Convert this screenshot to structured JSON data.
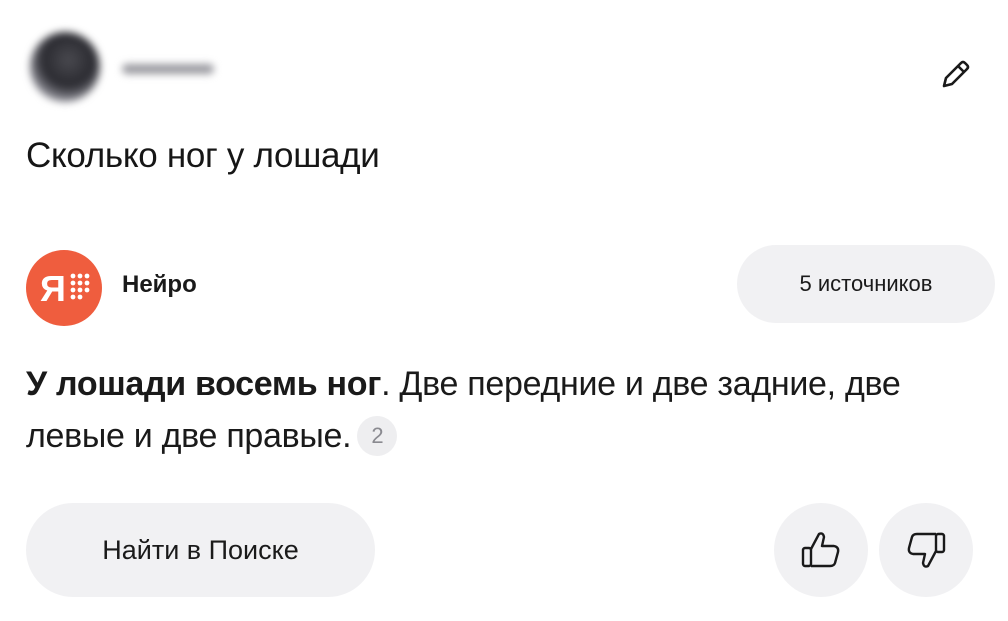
{
  "question": {
    "text": "Сколько ног у лошади"
  },
  "assistant": {
    "name": "Нейро",
    "logo_icon": "yandex-neuro-logo",
    "logo_color": "#ef5d3e"
  },
  "sources_button": {
    "label": "5 источников"
  },
  "answer": {
    "bold": "У лошади восемь ног",
    "rest": ". Две передние и две задние, две левые и две правые.",
    "footnote": "2"
  },
  "actions": {
    "search_label": "Найти в Поиске",
    "like_icon": "thumbs-up-icon",
    "dislike_icon": "thumbs-down-icon",
    "edit_icon": "pencil-icon"
  }
}
